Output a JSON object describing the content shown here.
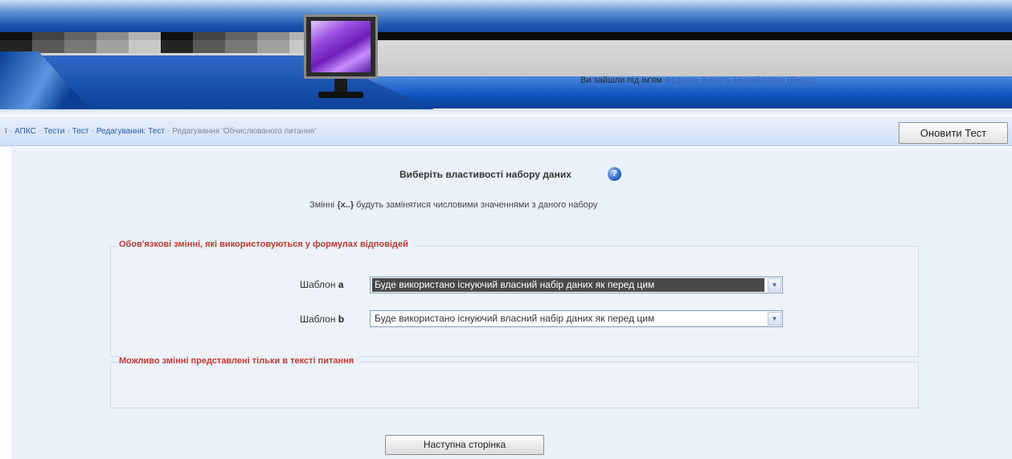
{
  "header": {
    "login_prefix": "Ви зайшли під ім'ям",
    "user_name": "Франчук Василь Михайлович",
    "logout_label": "(Вихід)"
  },
  "breadcrumb": {
    "items": [
      {
        "label": "ї"
      },
      {
        "label": "АПКС"
      },
      {
        "label": "Тести"
      },
      {
        "label": "Тест"
      },
      {
        "label": "Редагування: Тест"
      },
      {
        "label": "Редагування 'Обчислюваного питання'"
      }
    ]
  },
  "toolbar": {
    "update_label": "Оновити Тест"
  },
  "main": {
    "title": "Виберіть властивості набору даних",
    "help_icon_glyph": "?",
    "intro_prefix": "Змінні",
    "intro_bold": "{x..}",
    "intro_suffix": "будуть замінятися числовими значеннями з даного набору",
    "section1": {
      "legend": "Обов'язкові змінні, які використовуються у формулах відповідей",
      "rows": [
        {
          "label_prefix": "Шаблон",
          "var": "a",
          "value": "Буде використано існуючий власний набір даних як перед цим"
        },
        {
          "label_prefix": "Шаблон",
          "var": "b",
          "value": "Буде використано існуючий власний набір даних як перед цим"
        }
      ]
    },
    "section2": {
      "legend": "Можливо змінні представлені тільки в тексті питання"
    },
    "next_label": "Наступна сторінка"
  },
  "colors": {
    "header_blue": "#0f55c0",
    "legend_red": "#c0392b",
    "content_bg": "#eaf1fb",
    "link_blue": "#2957a6"
  }
}
